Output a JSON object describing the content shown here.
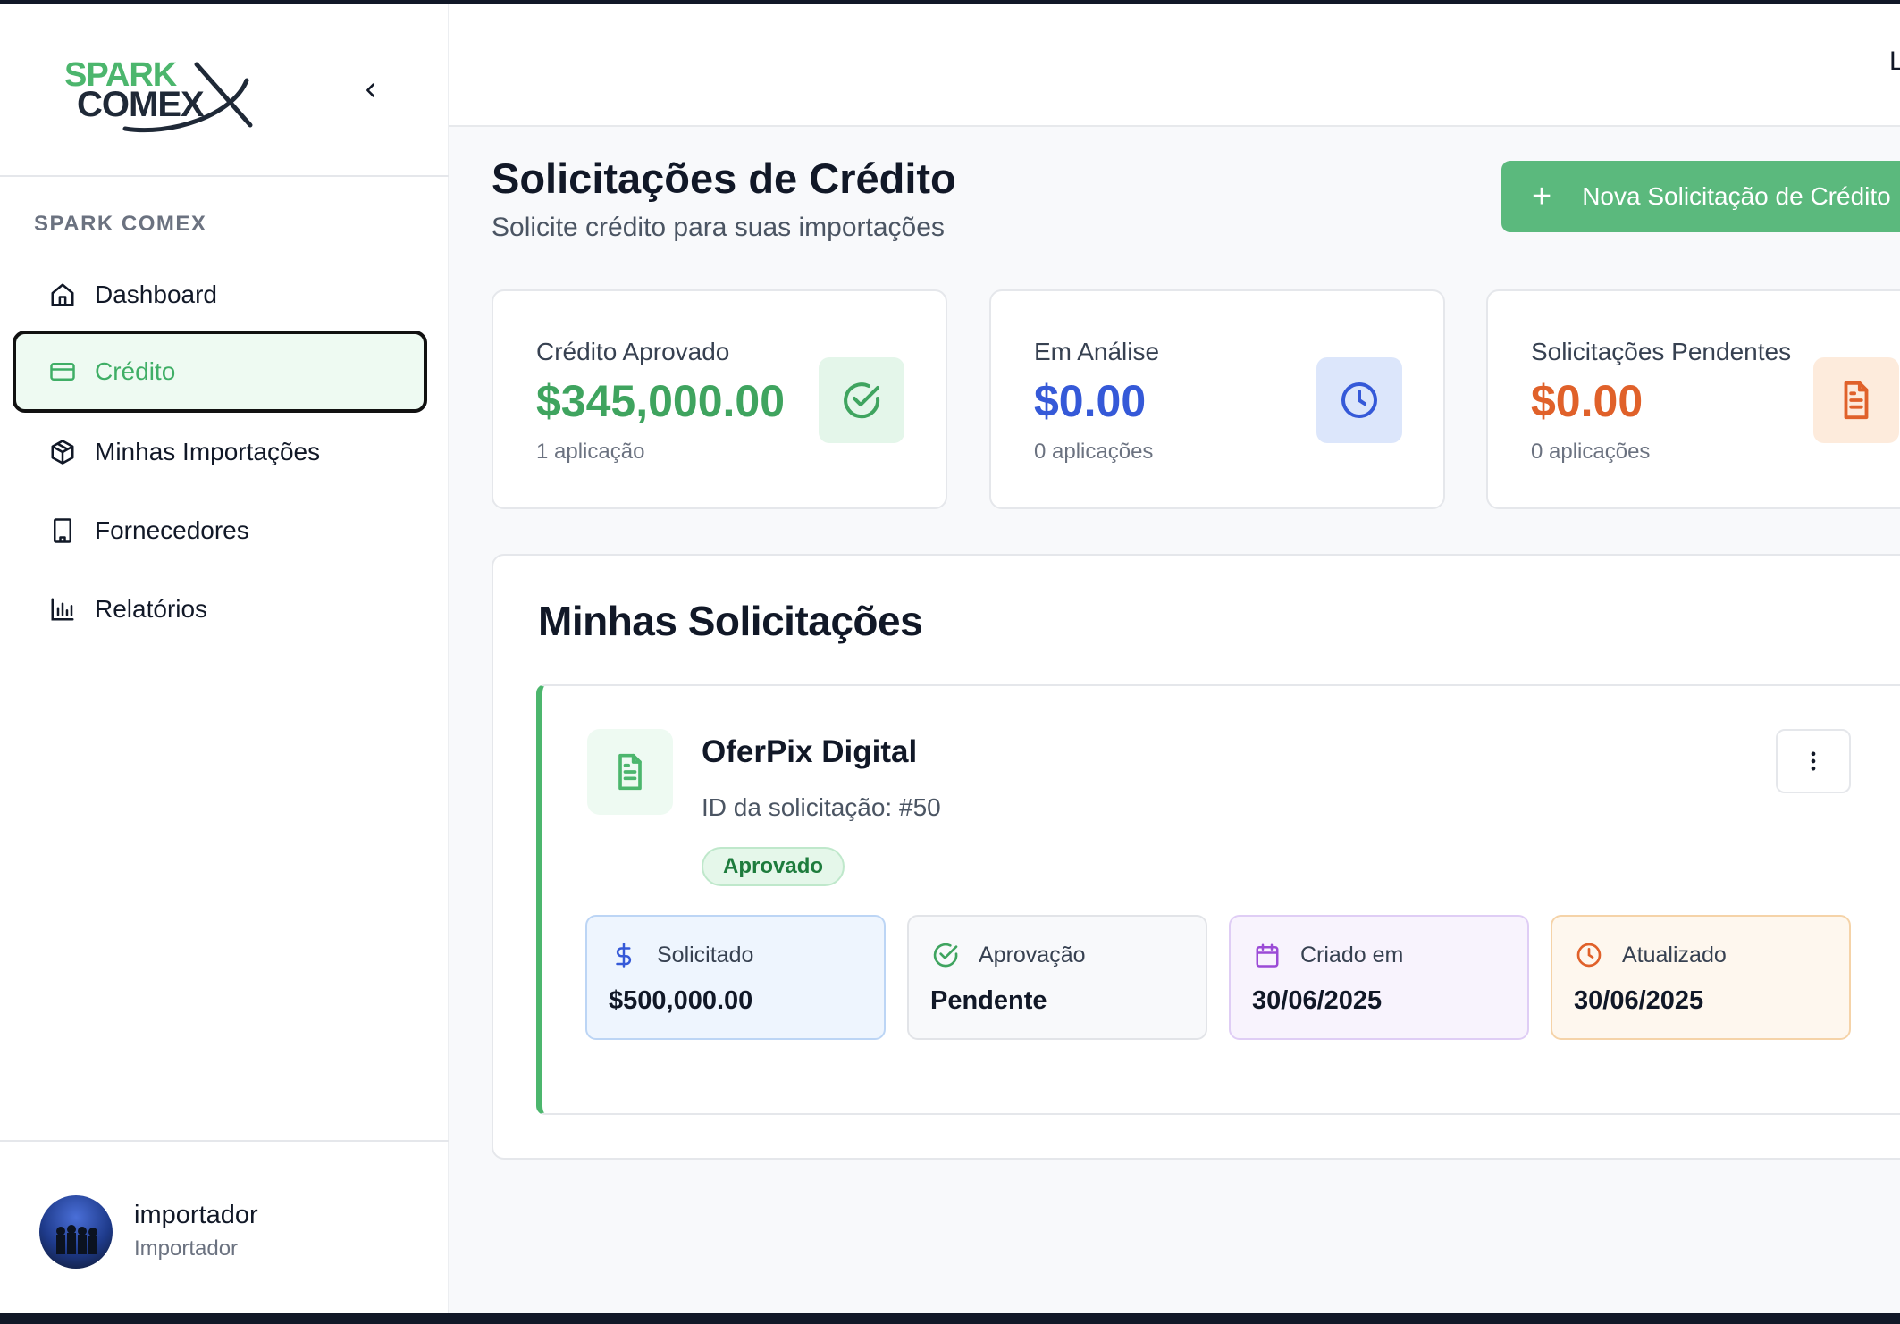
{
  "brand": {
    "logo_line1": "SPARK",
    "logo_line2": "COMEX",
    "section_title": "SPARK COMEX"
  },
  "colors": {
    "brand_green": "#4cb66d",
    "blue": "#3b5bdb",
    "orange": "#e8692c"
  },
  "sidebar": {
    "items": [
      {
        "label": "Dashboard",
        "icon": "home-icon"
      },
      {
        "label": "Crédito",
        "icon": "credit-card-icon",
        "active": true
      },
      {
        "label": "Minhas Importações",
        "icon": "package-icon"
      },
      {
        "label": "Fornecedores",
        "icon": "building-icon"
      },
      {
        "label": "Relatórios",
        "icon": "bar-chart-icon"
      }
    ]
  },
  "user": {
    "name": "importador",
    "role": "Importador"
  },
  "topbar": {
    "clipped_text": "L"
  },
  "page": {
    "title": "Solicitações de Crédito",
    "subtitle": "Solicite crédito para suas importações",
    "new_button": "Nova Solicitação de Crédito"
  },
  "stats": [
    {
      "label": "Crédito Aprovado",
      "value": "$345,000.00",
      "sub": "1 aplicação",
      "icon": "check-circle-icon",
      "color": "#3fa45f"
    },
    {
      "label": "Em Análise",
      "value": "$0.00",
      "sub": "0 aplicações",
      "icon": "clock-icon",
      "color": "#3559d8"
    },
    {
      "label": "Solicitações Pendentes",
      "value": "$0.00",
      "sub": "0 aplicações",
      "icon": "file-text-icon",
      "color": "#e0612a"
    }
  ],
  "requests": {
    "title": "Minhas Solicitações",
    "items": [
      {
        "company": "OferPix Digital",
        "id_text": "ID da solicitação: #50",
        "status": "Aprovado",
        "fields": [
          {
            "label": "Solicitado",
            "value": "$500,000.00",
            "icon": "dollar-icon"
          },
          {
            "label": "Aprovação",
            "value": "Pendente",
            "icon": "check-circle-icon"
          },
          {
            "label": "Criado em",
            "value": "30/06/2025",
            "icon": "calendar-icon"
          },
          {
            "label": "Atualizado",
            "value": "30/06/2025",
            "icon": "clock-icon"
          }
        ]
      }
    ]
  }
}
